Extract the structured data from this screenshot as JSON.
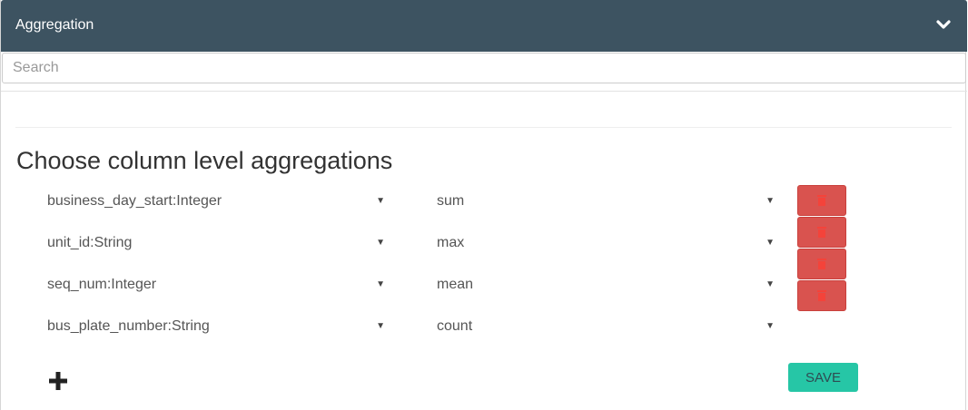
{
  "header": {
    "title": "Aggregation",
    "toggle_icon": "chevron-down-icon"
  },
  "search": {
    "placeholder": "Search"
  },
  "section": {
    "title": "Choose column level aggregations"
  },
  "rows": [
    {
      "column": "business_day_start:Integer",
      "aggregation": "sum"
    },
    {
      "column": "unit_id:String",
      "aggregation": "max"
    },
    {
      "column": "seq_num:Integer",
      "aggregation": "mean"
    },
    {
      "column": "bus_plate_number:String",
      "aggregation": "count"
    }
  ],
  "dropdown_arrow": "▼",
  "actions": {
    "add_icon": "plus-icon",
    "delete_icon": "trash-icon",
    "save_label": "SAVE"
  },
  "colors": {
    "header_bg": "#3d5361",
    "delete_bg": "#d9534f",
    "save_bg": "#26c6a6"
  }
}
